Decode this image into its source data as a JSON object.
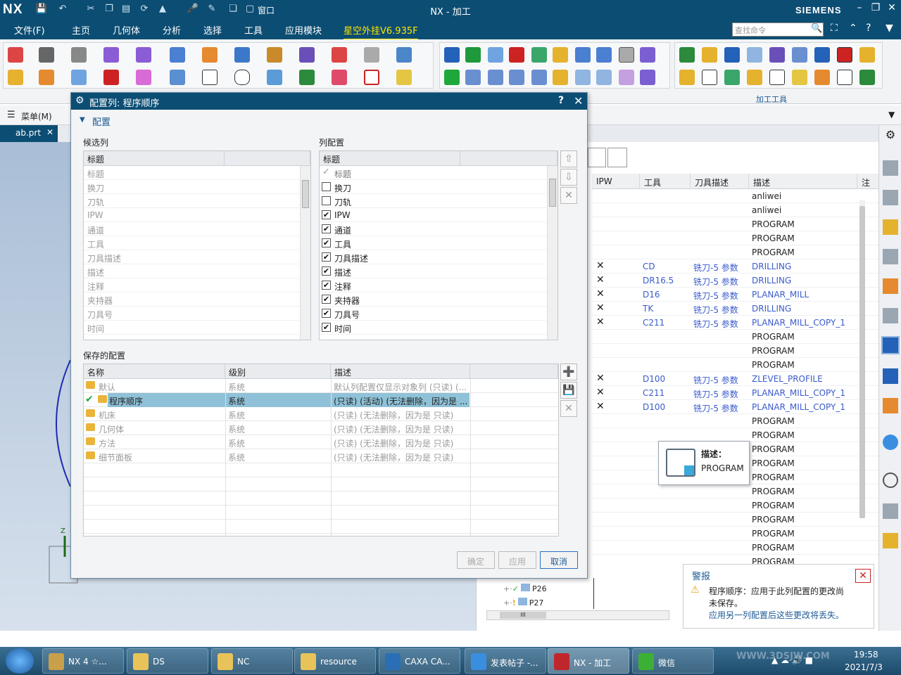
{
  "app": {
    "logo": "NX",
    "title": "NX - 加工",
    "brand": "SIEMENS",
    "window_menu_label": "窗口",
    "accent_color": "#0c4d73"
  },
  "menubar": {
    "items": [
      "文件(F)",
      "主页",
      "几何体",
      "分析",
      "选择",
      "工具",
      "应用模块",
      "星空外挂V6.935F"
    ],
    "search_placeholder": "查找命令"
  },
  "ribbon": {
    "group_label": "加工工具"
  },
  "subbar": {
    "menu_label": "菜单(M)"
  },
  "filetab": {
    "label": "ab.prt"
  },
  "dialog": {
    "title": "配置列: 程序顺序",
    "help": "?",
    "section": "配置",
    "candidate_label": "候选列",
    "column_label": "列配置",
    "saved_label": "保存的配置",
    "header_title": "标题",
    "candidates": [
      "标题",
      "换刀",
      "刀轨",
      "IPW",
      "通道",
      "工具",
      "刀具描述",
      "描述",
      "注释",
      "夹持器",
      "刀具号",
      "时间"
    ],
    "columns": [
      {
        "label": "标题",
        "state": "check"
      },
      {
        "label": "换刀",
        "state": "off"
      },
      {
        "label": "刀轨",
        "state": "off"
      },
      {
        "label": "IPW",
        "state": "on"
      },
      {
        "label": "通道",
        "state": "on"
      },
      {
        "label": "工具",
        "state": "on"
      },
      {
        "label": "刀具描述",
        "state": "on"
      },
      {
        "label": "描述",
        "state": "on"
      },
      {
        "label": "注释",
        "state": "on"
      },
      {
        "label": "夹持器",
        "state": "on"
      },
      {
        "label": "刀具号",
        "state": "on"
      },
      {
        "label": "时间",
        "state": "on"
      }
    ],
    "saved_headers": [
      "名称",
      "级别",
      "描述"
    ],
    "saved": [
      {
        "name": "默认",
        "level": "系统",
        "desc": "默认列配置仅显示对象列 (只读) (...",
        "active": false
      },
      {
        "name": "程序顺序",
        "level": "系统",
        "desc": "(只读) (活动) (无法删除，因为是 ...",
        "active": true
      },
      {
        "name": "机床",
        "level": "系统",
        "desc": "(只读) (无法删除，因为是 只读)",
        "active": false
      },
      {
        "name": "几何体",
        "level": "系统",
        "desc": "(只读) (无法删除，因为是 只读)",
        "active": false
      },
      {
        "name": "方法",
        "level": "系统",
        "desc": "(只读) (无法删除，因为是 只读)",
        "active": false
      },
      {
        "name": "细节面板",
        "level": "系统",
        "desc": "(只读) (无法删除，因为是 只读)",
        "active": false
      }
    ],
    "buttons": {
      "ok": "确定",
      "apply": "应用",
      "cancel": "取消"
    }
  },
  "navigator": {
    "headers": [
      "IPW",
      "工具",
      "刀具描述",
      "描述",
      "注"
    ],
    "rows": [
      {
        "x": false,
        "tool": "",
        "tdesc": "",
        "desc": "anliwei"
      },
      {
        "x": false,
        "tool": "",
        "tdesc": "",
        "desc": "anliwei"
      },
      {
        "x": false,
        "tool": "",
        "tdesc": "",
        "desc": "PROGRAM"
      },
      {
        "x": false,
        "tool": "",
        "tdesc": "",
        "desc": "PROGRAM"
      },
      {
        "x": false,
        "tool": "",
        "tdesc": "",
        "desc": "PROGRAM"
      },
      {
        "x": true,
        "tool": "CD",
        "tdesc": "铣刀-5 参数",
        "desc": "DRILLING"
      },
      {
        "x": true,
        "tool": "DR16.5",
        "tdesc": "铣刀-5 参数",
        "desc": "DRILLING"
      },
      {
        "x": true,
        "tool": "D16",
        "tdesc": "铣刀-5 参数",
        "desc": "PLANAR_MILL"
      },
      {
        "x": true,
        "tool": "TK",
        "tdesc": "铣刀-5 参数",
        "desc": "DRILLING"
      },
      {
        "x": true,
        "tool": "C211",
        "tdesc": "铣刀-5 参数",
        "desc": "PLANAR_MILL_COPY_1"
      },
      {
        "x": false,
        "tool": "",
        "tdesc": "",
        "desc": "PROGRAM"
      },
      {
        "x": false,
        "tool": "",
        "tdesc": "",
        "desc": "PROGRAM"
      },
      {
        "x": false,
        "tool": "",
        "tdesc": "",
        "desc": "PROGRAM"
      },
      {
        "x": true,
        "tool": "D100",
        "tdesc": "铣刀-5 参数",
        "desc": "ZLEVEL_PROFILE"
      },
      {
        "x": true,
        "tool": "C211",
        "tdesc": "铣刀-5 参数",
        "desc": "PLANAR_MILL_COPY_1"
      },
      {
        "x": true,
        "tool": "D100",
        "tdesc": "铣刀-5 参数",
        "desc": "PLANAR_MILL_COPY_1"
      },
      {
        "x": false,
        "tool": "",
        "tdesc": "",
        "desc": "PROGRAM"
      },
      {
        "x": false,
        "tool": "",
        "tdesc": "",
        "desc": "PROGRAM"
      },
      {
        "x": false,
        "tool": "",
        "tdesc": "",
        "desc": "PROGRAM"
      },
      {
        "x": false,
        "tool": "",
        "tdesc": "",
        "desc": "PROGRAM"
      },
      {
        "x": false,
        "tool": "",
        "tdesc": "",
        "desc": "PROGRAM"
      },
      {
        "x": false,
        "tool": "",
        "tdesc": "",
        "desc": "PROGRAM"
      },
      {
        "x": false,
        "tool": "",
        "tdesc": "",
        "desc": "PROGRAM"
      },
      {
        "x": false,
        "tool": "",
        "tdesc": "",
        "desc": "PROGRAM"
      },
      {
        "x": false,
        "tool": "",
        "tdesc": "",
        "desc": "PROGRAM"
      },
      {
        "x": false,
        "tool": "",
        "tdesc": "",
        "desc": "PROGRAM"
      },
      {
        "x": false,
        "tool": "",
        "tdesc": "",
        "desc": "PROGRAM"
      }
    ],
    "tree": [
      "P26",
      "P27"
    ],
    "scroll_label": "III"
  },
  "tooltip": {
    "label": "描述：",
    "value": "PROGRAM"
  },
  "alert": {
    "title": "警报",
    "message": "程序顺序：应用于此列配置的更改尚未保存。",
    "message2": "应用另一列配置后这些更改将丢失。"
  },
  "axis": {
    "z": "Z"
  },
  "taskbar": {
    "items": [
      {
        "label": "NX 4 ☆...",
        "color": "#c8a04a"
      },
      {
        "label": "DS",
        "color": "#e8c35a"
      },
      {
        "label": "NC",
        "color": "#e8c35a"
      },
      {
        "label": "resource",
        "color": "#e8c35a"
      },
      {
        "label": "CAXA CA...",
        "color": "#2a6fb5"
      },
      {
        "label": "发表帖子 -...",
        "color": "#3a8ee0"
      },
      {
        "label": "NX - 加工",
        "color": "#c0272d"
      },
      {
        "label": "微信",
        "color": "#3cb034"
      }
    ],
    "time": "19:58",
    "date": "2021/7/3",
    "watermark": "WWW.3DSJW.COM"
  }
}
